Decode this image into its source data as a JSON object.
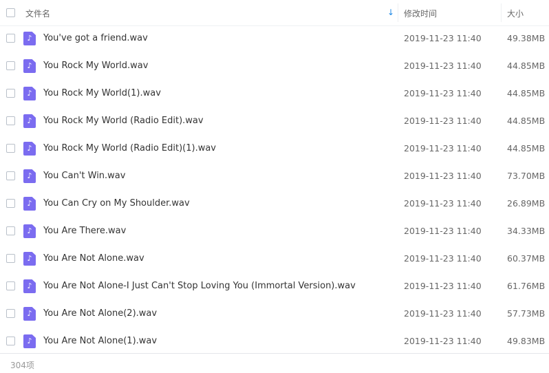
{
  "header": {
    "name_label": "文件名",
    "date_label": "修改时间",
    "size_label": "大小",
    "sort_icon": "↓"
  },
  "files": [
    {
      "name": "You've got a friend.wav",
      "modified": "2019-11-23 11:40",
      "size": "49.38MB"
    },
    {
      "name": "You Rock My World.wav",
      "modified": "2019-11-23 11:40",
      "size": "44.85MB"
    },
    {
      "name": "You Rock My World(1).wav",
      "modified": "2019-11-23 11:40",
      "size": "44.85MB"
    },
    {
      "name": "You Rock My World (Radio Edit).wav",
      "modified": "2019-11-23 11:40",
      "size": "44.85MB"
    },
    {
      "name": "You Rock My World (Radio Edit)(1).wav",
      "modified": "2019-11-23 11:40",
      "size": "44.85MB"
    },
    {
      "name": "You Can't Win.wav",
      "modified": "2019-11-23 11:40",
      "size": "73.70MB"
    },
    {
      "name": "You Can Cry on My Shoulder.wav",
      "modified": "2019-11-23 11:40",
      "size": "26.89MB"
    },
    {
      "name": "You Are There.wav",
      "modified": "2019-11-23 11:40",
      "size": "34.33MB"
    },
    {
      "name": "You Are Not Alone.wav",
      "modified": "2019-11-23 11:40",
      "size": "60.37MB"
    },
    {
      "name": "You Are Not Alone-I Just Can't Stop Loving You (Immortal Version).wav",
      "modified": "2019-11-23 11:40",
      "size": "61.76MB"
    },
    {
      "name": "You Are Not Alone(2).wav",
      "modified": "2019-11-23 11:40",
      "size": "57.73MB"
    },
    {
      "name": "You Are Not Alone(1).wav",
      "modified": "2019-11-23 11:40",
      "size": "49.83MB"
    }
  ],
  "file_icon_glyph": "♪",
  "footer": {
    "count": "304项"
  }
}
